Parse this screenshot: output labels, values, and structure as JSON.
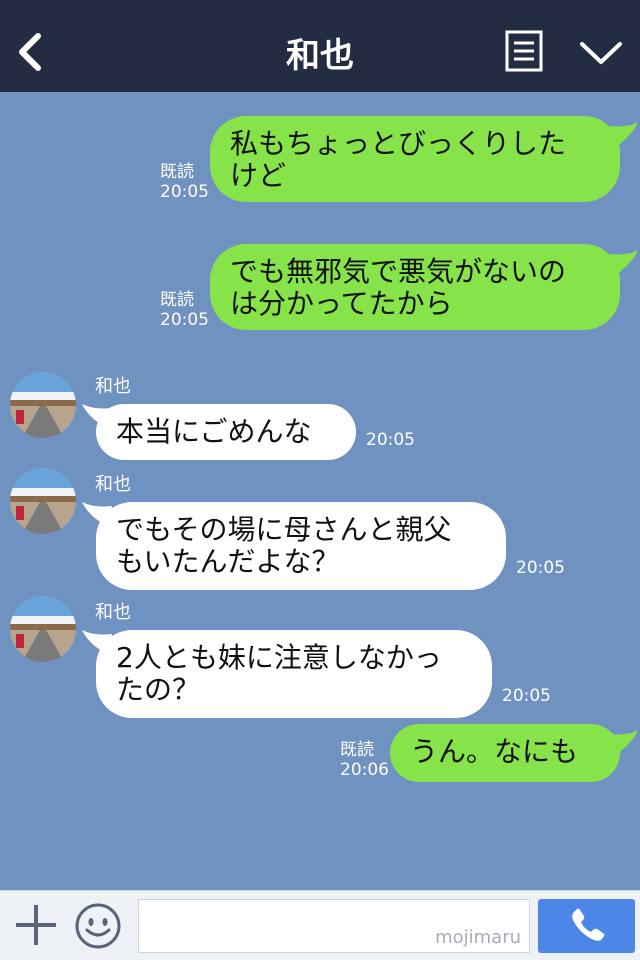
{
  "header": {
    "title": "和也",
    "back_icon": "chevron-left-icon",
    "note_icon": "note-icon",
    "menu_icon": "chevron-down-icon"
  },
  "messages": [
    {
      "side": "right",
      "text": "私もちょっとびっくりした\nけど",
      "read": "既読",
      "time": "20:05"
    },
    {
      "side": "right",
      "text": "でも無邪気で悪気がないの\nは分かってたから",
      "read": "既読",
      "time": "20:05"
    },
    {
      "side": "left",
      "sender": "和也",
      "text": "本当にごめんな",
      "time": "20:05"
    },
    {
      "side": "left",
      "sender": "和也",
      "text": "でもその場に母さんと親父\nもいたんだよな？",
      "time": "20:05"
    },
    {
      "side": "left",
      "sender": "和也",
      "text": "2人とも妹に注意しなかっ\nたの？",
      "time": "20:05"
    },
    {
      "side": "right",
      "text": "うん。なにも",
      "read": "既読",
      "time": "20:06"
    }
  ],
  "footer": {
    "plus_icon": "plus-icon",
    "emoji_icon": "smiley-icon",
    "input_placeholder": "",
    "watermark": "mojimaru",
    "call_icon": "phone-icon"
  },
  "colors": {
    "background": "#7092c0",
    "header": "#232c43",
    "my_bubble": "#86e349",
    "their_bubble": "#ffffff",
    "call_button": "#4c87e8"
  }
}
